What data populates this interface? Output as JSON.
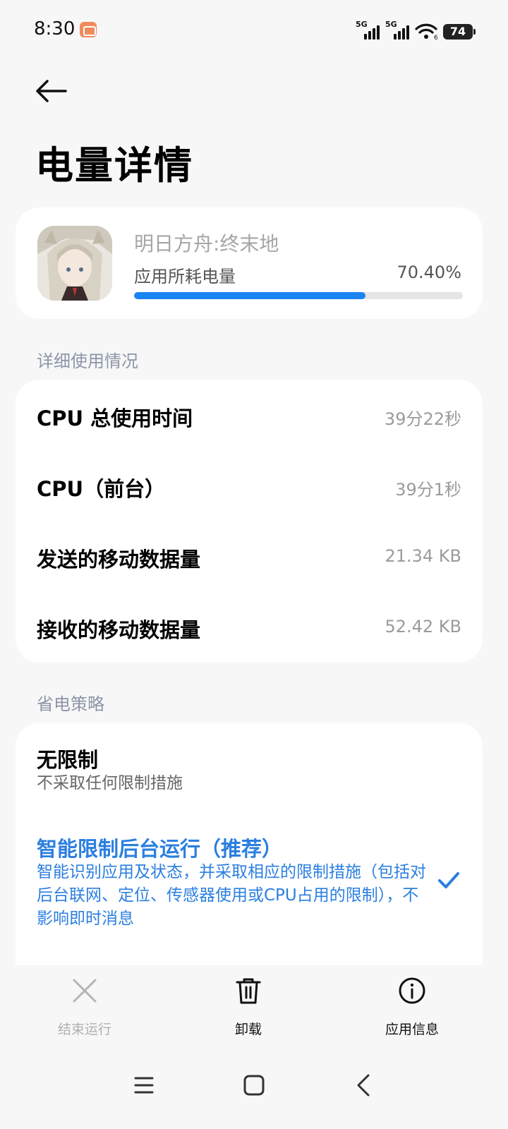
{
  "status_bar": {
    "time": "8:30",
    "network1": "5G",
    "network2": "5G",
    "wifi_sub": "6",
    "battery": "74"
  },
  "header": {
    "title": "电量详情"
  },
  "app": {
    "name": "明日方舟:终末地",
    "usage_label": "应用所耗电量",
    "usage_value": "70.40%",
    "usage_fraction": 0.704,
    "accent": "#1a84f1"
  },
  "details": {
    "section_title": "详细使用情况",
    "rows": [
      {
        "label": "CPU 总使用时间",
        "value": "39分22秒"
      },
      {
        "label": "CPU（前台）",
        "value": "39分1秒"
      },
      {
        "label": "发送的移动数据量",
        "value": "21.34 KB"
      },
      {
        "label": "接收的移动数据量",
        "value": "52.42 KB"
      }
    ]
  },
  "policy": {
    "section_title": "省电策略",
    "options": [
      {
        "title": "无限制",
        "desc": "不采取任何限制措施",
        "selected": false
      },
      {
        "title": "智能限制后台运行（推荐）",
        "desc": "智能识别应用及状态，并采取相应的限制措施（包括对后台联网、定位、传感器使用或CPU占用的限制），不影响即时消息",
        "selected": true
      }
    ],
    "selected_color": "#2b7fe0"
  },
  "actions": {
    "stop": "结束运行",
    "uninstall": "卸载",
    "app_info": "应用信息"
  }
}
